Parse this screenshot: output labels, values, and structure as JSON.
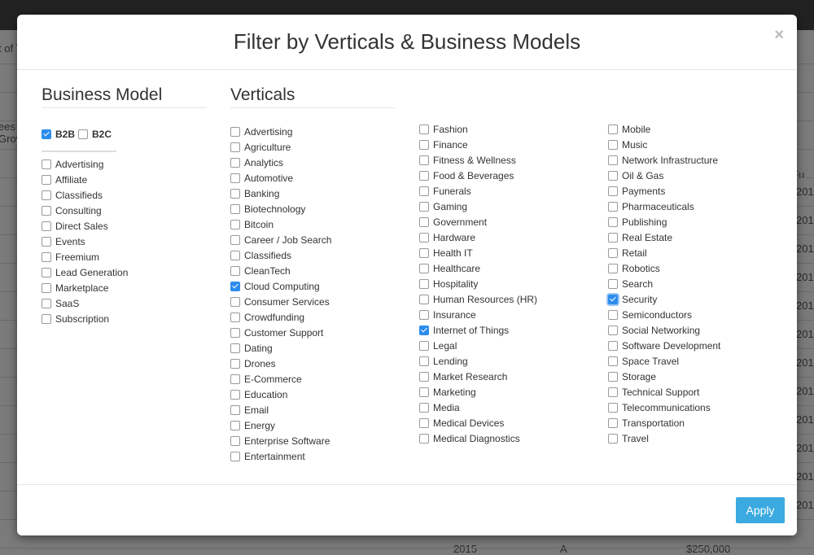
{
  "background": {
    "fragments": [
      "t of T",
      "ees",
      "Grov",
      "t Fu",
      "201",
      "201",
      "201",
      "201",
      "201",
      "201",
      "201",
      "201",
      "201",
      "201",
      "201",
      "201",
      "2015",
      "A",
      "$250,000"
    ]
  },
  "modal": {
    "title": "Filter by Verticals & Business Models",
    "close_label": "×",
    "apply_label": "Apply",
    "accent_color": "#3aaae0",
    "business_model": {
      "heading": "Business Model",
      "top": [
        {
          "label": "B2B",
          "checked": true
        },
        {
          "label": "B2C",
          "checked": false
        }
      ],
      "items": [
        {
          "label": "Advertising",
          "checked": false
        },
        {
          "label": "Affiliate",
          "checked": false
        },
        {
          "label": "Classifieds",
          "checked": false
        },
        {
          "label": "Consulting",
          "checked": false
        },
        {
          "label": "Direct Sales",
          "checked": false
        },
        {
          "label": "Events",
          "checked": false
        },
        {
          "label": "Freemium",
          "checked": false
        },
        {
          "label": "Lead Generation",
          "checked": false
        },
        {
          "label": "Marketplace",
          "checked": false
        },
        {
          "label": "SaaS",
          "checked": false
        },
        {
          "label": "Subscription",
          "checked": false
        }
      ]
    },
    "verticals": {
      "heading": "Verticals",
      "columns": [
        [
          {
            "label": "Advertising",
            "checked": false
          },
          {
            "label": "Agriculture",
            "checked": false
          },
          {
            "label": "Analytics",
            "checked": false
          },
          {
            "label": "Automotive",
            "checked": false
          },
          {
            "label": "Banking",
            "checked": false
          },
          {
            "label": "Biotechnology",
            "checked": false
          },
          {
            "label": "Bitcoin",
            "checked": false
          },
          {
            "label": "Career / Job Search",
            "checked": false
          },
          {
            "label": "Classifieds",
            "checked": false
          },
          {
            "label": "CleanTech",
            "checked": false
          },
          {
            "label": "Cloud Computing",
            "checked": true
          },
          {
            "label": "Consumer Services",
            "checked": false
          },
          {
            "label": "Crowdfunding",
            "checked": false
          },
          {
            "label": "Customer Support",
            "checked": false
          },
          {
            "label": "Dating",
            "checked": false
          },
          {
            "label": "Drones",
            "checked": false
          },
          {
            "label": "E-Commerce",
            "checked": false
          },
          {
            "label": "Education",
            "checked": false
          },
          {
            "label": "Email",
            "checked": false
          },
          {
            "label": "Energy",
            "checked": false
          },
          {
            "label": "Enterprise Software",
            "checked": false
          },
          {
            "label": "Entertainment",
            "checked": false
          }
        ],
        [
          {
            "label": "Fashion",
            "checked": false
          },
          {
            "label": "Finance",
            "checked": false
          },
          {
            "label": "Fitness & Wellness",
            "checked": false
          },
          {
            "label": "Food & Beverages",
            "checked": false
          },
          {
            "label": "Funerals",
            "checked": false
          },
          {
            "label": "Gaming",
            "checked": false
          },
          {
            "label": "Government",
            "checked": false
          },
          {
            "label": "Hardware",
            "checked": false
          },
          {
            "label": "Health IT",
            "checked": false
          },
          {
            "label": "Healthcare",
            "checked": false
          },
          {
            "label": "Hospitality",
            "checked": false
          },
          {
            "label": "Human Resources (HR)",
            "checked": false
          },
          {
            "label": "Insurance",
            "checked": false
          },
          {
            "label": "Internet of Things",
            "checked": true
          },
          {
            "label": "Legal",
            "checked": false
          },
          {
            "label": "Lending",
            "checked": false
          },
          {
            "label": "Market Research",
            "checked": false
          },
          {
            "label": "Marketing",
            "checked": false
          },
          {
            "label": "Media",
            "checked": false
          },
          {
            "label": "Medical Devices",
            "checked": false
          },
          {
            "label": "Medical Diagnostics",
            "checked": false
          }
        ],
        [
          {
            "label": "Mobile",
            "checked": false
          },
          {
            "label": "Music",
            "checked": false
          },
          {
            "label": "Network Infrastructure",
            "checked": false
          },
          {
            "label": "Oil & Gas",
            "checked": false
          },
          {
            "label": "Payments",
            "checked": false
          },
          {
            "label": "Pharmaceuticals",
            "checked": false
          },
          {
            "label": "Publishing",
            "checked": false
          },
          {
            "label": "Real Estate",
            "checked": false
          },
          {
            "label": "Retail",
            "checked": false
          },
          {
            "label": "Robotics",
            "checked": false
          },
          {
            "label": "Search",
            "checked": false
          },
          {
            "label": "Security",
            "checked": true,
            "focused": true
          },
          {
            "label": "Semiconductors",
            "checked": false
          },
          {
            "label": "Social Networking",
            "checked": false
          },
          {
            "label": "Software Development",
            "checked": false
          },
          {
            "label": "Space Travel",
            "checked": false
          },
          {
            "label": "Storage",
            "checked": false
          },
          {
            "label": "Technical Support",
            "checked": false
          },
          {
            "label": "Telecommunications",
            "checked": false
          },
          {
            "label": "Transportation",
            "checked": false
          },
          {
            "label": "Travel",
            "checked": false
          }
        ]
      ]
    }
  }
}
